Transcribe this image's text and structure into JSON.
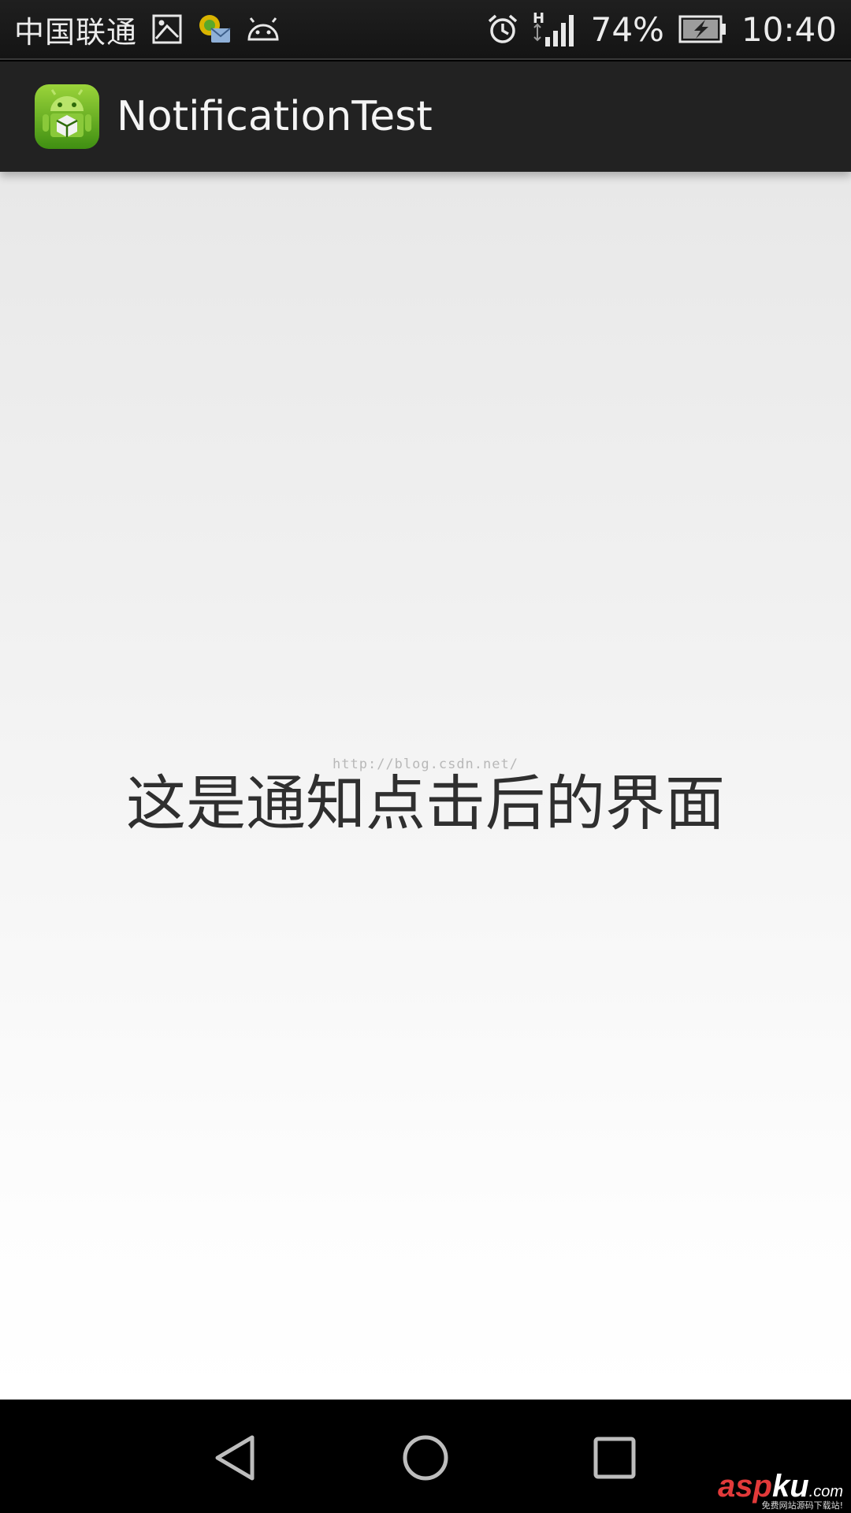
{
  "status_bar": {
    "carrier": "中国联通",
    "battery_percent": "74%",
    "time": "10:40",
    "network_type": "H",
    "icons": [
      "gallery-icon",
      "messenger-icon",
      "android-icon",
      "alarm-icon",
      "signal-icon",
      "battery-charging-icon"
    ]
  },
  "action_bar": {
    "title": "NotificationTest",
    "app_icon": "android-app-icon"
  },
  "main": {
    "message": "这是通知点击后的界面",
    "watermark_url": "http://blog.csdn.net/"
  },
  "nav_bar": {
    "buttons": [
      "back-icon",
      "home-icon",
      "recent-apps-icon"
    ]
  },
  "site_watermark": {
    "brand_prefix": "asp",
    "brand_suffix": "ku",
    "domain": ".com",
    "tagline": "免费网站源码下载站!"
  },
  "colors": {
    "status_bar": "#1a1a1a",
    "action_bar": "#222222",
    "content_top": "#e8e8e8",
    "content_bottom": "#ffffff",
    "nav_bar": "#000000",
    "text": "#2f2f2f",
    "brand_red": "#e23a3a"
  }
}
